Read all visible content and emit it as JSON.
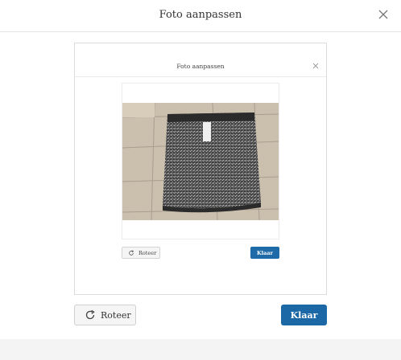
{
  "modal": {
    "title": "Foto aanpassen",
    "rotate_label": "Roteer",
    "done_label": "Klaar"
  },
  "inner_modal": {
    "title": "Foto aanpassen",
    "rotate_label": "Roteer",
    "done_label": "Klaar"
  },
  "icons": {
    "close": "close-icon",
    "rotate": "rotate-icon"
  },
  "colors": {
    "primary_button": "#1c67a6",
    "secondary_button": "#f5f5f5"
  }
}
